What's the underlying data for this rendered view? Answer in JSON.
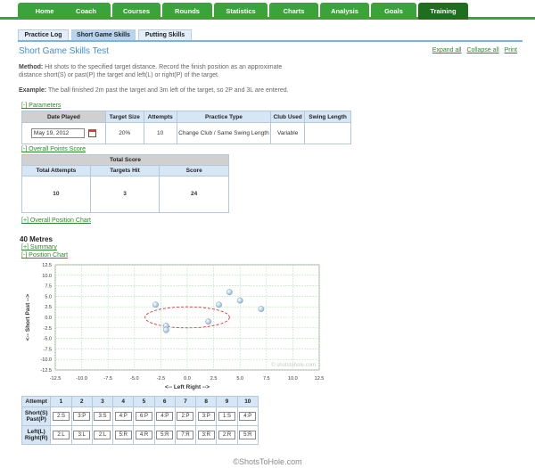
{
  "nav": {
    "items": [
      "Home",
      "Coach",
      "Courses",
      "Rounds",
      "Statistics",
      "Charts",
      "Analysis",
      "Goals",
      "Training"
    ],
    "active": "Training"
  },
  "subnav": {
    "items": [
      "Practice Log",
      "Short Game Skills",
      "Putting Skills"
    ],
    "active": "Short Game Skills"
  },
  "page": {
    "title": "Short Game Skills Test",
    "links": [
      "Expand all",
      "Collapse all",
      "Print"
    ]
  },
  "method": {
    "label": "Method:",
    "text_line1": "Hit shots to the specified target distance. Record the finish position as an approximate",
    "text_line2": "distance short(S) or past(P) the target and left(L) or right(P) of the target."
  },
  "example": {
    "label": "Example:",
    "text": "The ball finished 2m past the target and 3m left of the target, so 2P and 3L are entered."
  },
  "parameters": {
    "link": "[-] Parameters",
    "headers": [
      "Date Played",
      "Target Size",
      "Attempts",
      "Practice Type",
      "Club Used",
      "Swing Length"
    ],
    "date_value": "May 19, 2012",
    "target_size": "20%",
    "attempts": "10",
    "practice_type": "Change Club / Same Swing Length",
    "club_used": "Variable",
    "swing_length": ""
  },
  "score": {
    "link": "[-] Overall Points Score",
    "title": "Total Score",
    "headers": [
      "Total Attempts",
      "Targets Hit",
      "Score"
    ],
    "values": [
      "10",
      "3",
      "24"
    ]
  },
  "position_link": "[+] Overall Position Chart",
  "distance": {
    "heading": "40 Metres",
    "summary_link": "[+] Summary",
    "chart_link": "[-] Position Chart"
  },
  "chart_data": {
    "type": "scatter",
    "xlabel": "<-- Left   Right -->",
    "ylabel": "<-- Short   Past -->",
    "xlim": [
      -12.5,
      12.5
    ],
    "ylim": [
      -12.5,
      12.5
    ],
    "xticks": [
      -12.5,
      -10.0,
      -7.5,
      -5.0,
      -2.5,
      0.0,
      2.5,
      5.0,
      7.5,
      10.0,
      12.5
    ],
    "yticks": [
      12.5,
      10.0,
      7.5,
      5.0,
      2.5,
      0.0,
      -2.5,
      -5.0,
      -7.5,
      -10.0,
      -12.5
    ],
    "xtick_labels": [
      "-12.5",
      "-10.0",
      "-7.5",
      "-5.0",
      "-2.5",
      "0.0",
      "2.5",
      "5.0",
      "7.5",
      "10.0",
      "12.5"
    ],
    "ytick_labels": [
      "12.5",
      "10.0",
      "7.5",
      "5.0",
      "2.5",
      "0.0",
      "-2.5",
      "-5.0",
      "-7.5",
      "-10.0",
      "-12.5"
    ],
    "grid": true,
    "watermark": "© shotstohole.com",
    "points": [
      {
        "x": -2,
        "y": -2
      },
      {
        "x": -3,
        "y": 3
      },
      {
        "x": -2,
        "y": -3
      },
      {
        "x": 2,
        "y": -1
      },
      {
        "x": 3,
        "y": 3
      },
      {
        "x": 4,
        "y": 6
      },
      {
        "x": 5,
        "y": 4
      },
      {
        "x": 7,
        "y": 2
      }
    ],
    "target_ellipse": {
      "cx": 0,
      "cy": 0,
      "rx": 4,
      "ry": 2.5
    },
    "colors": {
      "grid": "#b8e6b8",
      "ellipse": "#e02020",
      "point": "#8fb8d8",
      "border": "#888888"
    }
  },
  "attempts_table": {
    "row_headers": [
      "Attempt",
      "Short(S)\nPast(P)",
      "Left(L)\nRight(R)"
    ],
    "row_header_lines": [
      [
        "Attempt"
      ],
      [
        "Short(S)",
        "Past(P)"
      ],
      [
        "Left(L)",
        "Right(R)"
      ]
    ],
    "attempts": [
      "1",
      "2",
      "3",
      "4",
      "5",
      "6",
      "7",
      "8",
      "9",
      "10"
    ],
    "short_past": [
      "2:S",
      "3:P",
      "3:S",
      "4:P",
      "6:P",
      "4:P",
      "2:P",
      "3:P",
      "1:S",
      "4:P"
    ],
    "left_right": [
      "2:L",
      "3:L",
      "2:L",
      "5:R",
      "4:R",
      "5:R",
      "7:R",
      "3:R",
      "2:R",
      "5:R"
    ]
  },
  "footer": "©ShotsToHole.com"
}
